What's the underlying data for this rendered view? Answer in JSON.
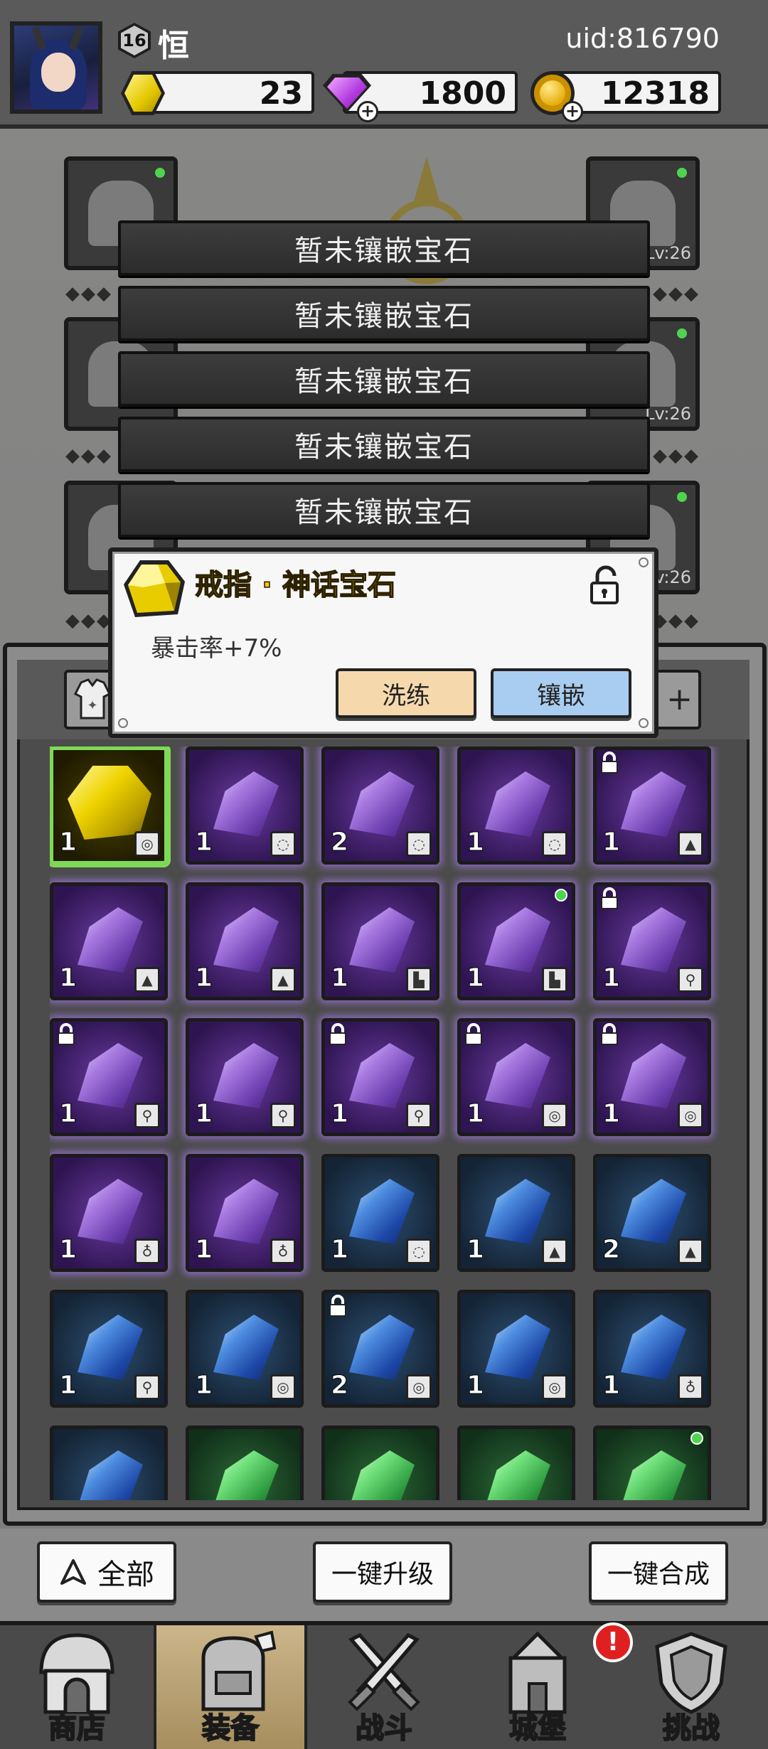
{
  "player": {
    "level": "16",
    "name": "恒",
    "uid": "uid:816790"
  },
  "resources": {
    "gold_gem": "23",
    "diamond": "1800",
    "coin": "12318"
  },
  "equipment": {
    "slot_levels": [
      "Lv:26",
      "Lv:26",
      "Lv:26",
      "Lv:26"
    ]
  },
  "gem_slots": [
    "暂未镶嵌宝石",
    "暂未镶嵌宝石",
    "暂未镶嵌宝石",
    "暂未镶嵌宝石",
    "暂未镶嵌宝石"
  ],
  "popup": {
    "title": "戒指 · 神话宝石",
    "stat": "暴击率+7%",
    "refine_label": "洗练",
    "inlay_label": "镶嵌"
  },
  "inventory": {
    "tab_right_label": "+",
    "gems": [
      {
        "color": "gold",
        "count": "1",
        "type": "ring-icon",
        "locked": false,
        "dot": false
      },
      {
        "color": "purple",
        "count": "1",
        "type": "necklace-icon",
        "locked": false,
        "dot": false
      },
      {
        "color": "purple",
        "count": "2",
        "type": "necklace-icon",
        "locked": false,
        "dot": false
      },
      {
        "color": "purple",
        "count": "1",
        "type": "necklace-icon",
        "locked": false,
        "dot": false
      },
      {
        "color": "purple",
        "count": "1",
        "type": "armor-icon",
        "locked": true,
        "dot": false
      },
      {
        "color": "purple",
        "count": "1",
        "type": "armor-icon",
        "locked": false,
        "dot": false
      },
      {
        "color": "purple",
        "count": "1",
        "type": "armor-icon",
        "locked": false,
        "dot": false
      },
      {
        "color": "purple",
        "count": "1",
        "type": "boot-icon",
        "locked": false,
        "dot": false
      },
      {
        "color": "purple",
        "count": "1",
        "type": "boot-icon",
        "locked": false,
        "dot": true
      },
      {
        "color": "purple",
        "count": "1",
        "type": "weapon-icon",
        "locked": true,
        "dot": false
      },
      {
        "color": "purple",
        "count": "1",
        "type": "weapon-icon",
        "locked": true,
        "dot": false
      },
      {
        "color": "purple",
        "count": "1",
        "type": "weapon-icon",
        "locked": false,
        "dot": false
      },
      {
        "color": "purple",
        "count": "1",
        "type": "weapon-icon",
        "locked": true,
        "dot": false
      },
      {
        "color": "purple",
        "count": "1",
        "type": "ring-icon",
        "locked": true,
        "dot": false
      },
      {
        "color": "purple",
        "count": "1",
        "type": "ring-icon",
        "locked": true,
        "dot": false
      },
      {
        "color": "purple",
        "count": "1",
        "type": "amulet-icon",
        "locked": false,
        "dot": false
      },
      {
        "color": "purple",
        "count": "1",
        "type": "amulet-icon",
        "locked": false,
        "dot": false
      },
      {
        "color": "blue",
        "count": "1",
        "type": "necklace-icon",
        "locked": false,
        "dot": false
      },
      {
        "color": "blue",
        "count": "1",
        "type": "armor-icon",
        "locked": false,
        "dot": false
      },
      {
        "color": "blue",
        "count": "2",
        "type": "armor-icon",
        "locked": false,
        "dot": false
      },
      {
        "color": "blue",
        "count": "1",
        "type": "weapon-icon",
        "locked": false,
        "dot": false
      },
      {
        "color": "blue",
        "count": "1",
        "type": "ring-icon",
        "locked": false,
        "dot": false
      },
      {
        "color": "blue",
        "count": "2",
        "type": "ring-icon",
        "locked": true,
        "dot": false
      },
      {
        "color": "blue",
        "count": "1",
        "type": "ring-icon",
        "locked": false,
        "dot": false
      },
      {
        "color": "blue",
        "count": "1",
        "type": "amulet-icon",
        "locked": false,
        "dot": false
      },
      {
        "color": "blue",
        "count": "",
        "type": "",
        "locked": false,
        "dot": false
      },
      {
        "color": "green",
        "count": "",
        "type": "",
        "locked": false,
        "dot": false
      },
      {
        "color": "green",
        "count": "",
        "type": "",
        "locked": false,
        "dot": false
      },
      {
        "color": "green",
        "count": "",
        "type": "",
        "locked": false,
        "dot": false
      },
      {
        "color": "green",
        "count": "",
        "type": "",
        "locked": false,
        "dot": true
      }
    ]
  },
  "actions": {
    "all_label": "全部",
    "upgrade_label": "一键升级",
    "merge_label": "一键合成"
  },
  "nav": {
    "shop": "商店",
    "equip": "装备",
    "battle": "战斗",
    "castle": "城堡",
    "challenge": "挑战",
    "castle_badge": "!"
  }
}
